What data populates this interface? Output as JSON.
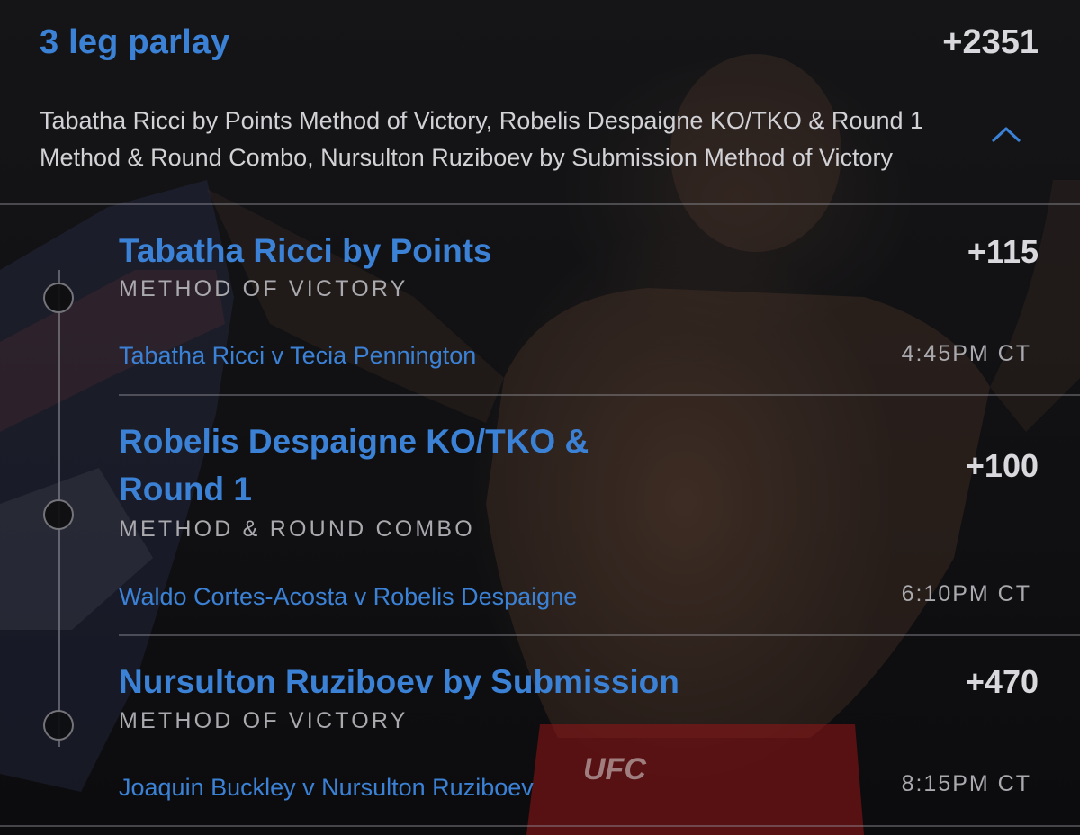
{
  "parlay": {
    "title": "3 leg parlay",
    "odds": "+2351",
    "summary": "Tabatha Ricci by Points Method of Victory, Robelis Despaigne KO/TKO & Round 1 Method & Round Combo, Nursulton Ruziboev by Submission Method of Victory",
    "toggle_icon": "chevron-up-icon"
  },
  "legs": [
    {
      "selection": "Tabatha Ricci by Points",
      "odds": "+115",
      "market": "METHOD OF VICTORY",
      "matchup": "Tabatha Ricci v Tecia Pennington",
      "time": "4:45PM CT"
    },
    {
      "selection": "Robelis Despaigne KO/TKO & Round 1",
      "odds": "+100",
      "market": "METHOD & ROUND COMBO",
      "matchup": "Waldo Cortes-Acosta v Robelis Despaigne",
      "time": "6:10PM CT"
    },
    {
      "selection": "Nursulton Ruziboev by Submission",
      "odds": "+470",
      "market": "METHOD OF VICTORY",
      "matchup": "Joaquin Buckley v Nursulton Ruziboev",
      "time": "8:15PM CT"
    }
  ],
  "background": {
    "logo_text": "UFC"
  },
  "colors": {
    "accent": "#3b82d6",
    "odds_text": "#d9d9dd",
    "secondary_text": "#a9a9ae",
    "background": "#0d0d0f"
  }
}
